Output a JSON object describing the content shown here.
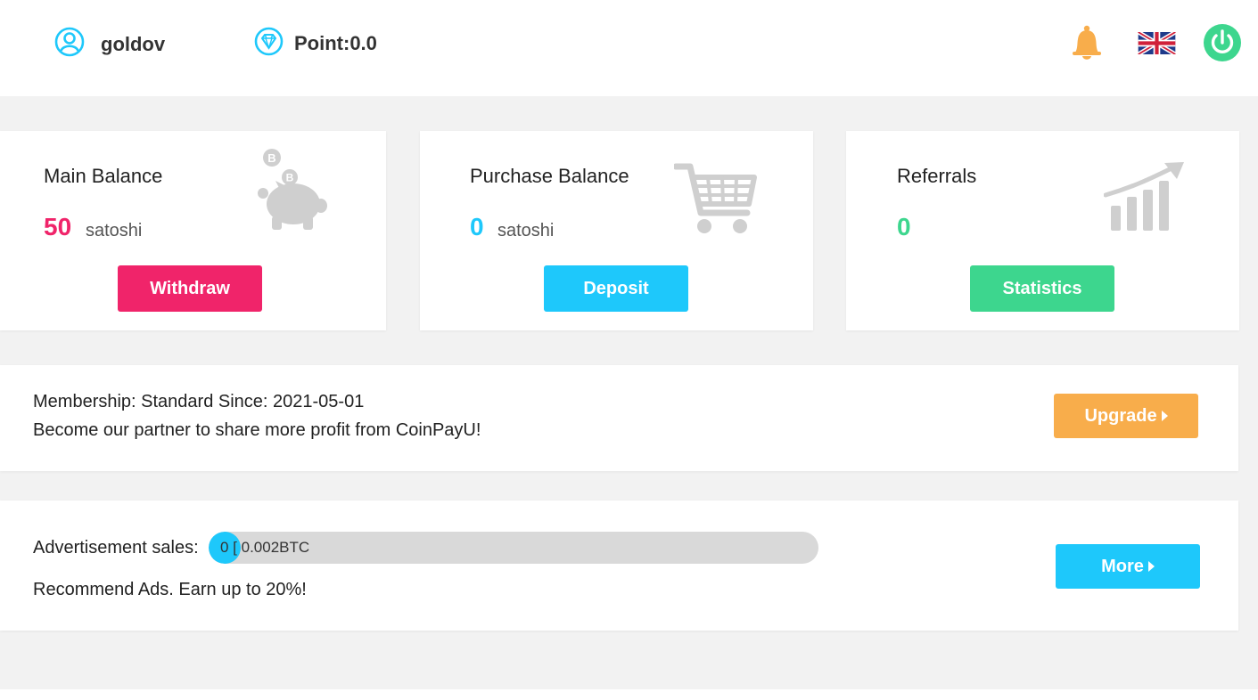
{
  "header": {
    "username": "goldov",
    "points": "Point:0.0",
    "icons": [
      "user-icon",
      "diamond-icon",
      "bell-icon",
      "uk-flag-icon",
      "power-icon"
    ]
  },
  "cards": [
    {
      "title": "Main Balance",
      "amount": "50",
      "unit": "satoshi",
      "button": "Withdraw",
      "color": "#f0246a",
      "icon": "piggy-bank-icon"
    },
    {
      "title": "Purchase Balance",
      "amount": "0",
      "unit": "satoshi",
      "button": "Deposit",
      "color": "#1ec8fb",
      "icon": "shopping-cart-icon"
    },
    {
      "title": "Referrals",
      "amount": "0",
      "unit": "",
      "button": "Statistics",
      "color": "#3dd68e",
      "icon": "growth-chart-icon"
    }
  ],
  "membership": {
    "line1": "Membership: Standard Since: 2021-05-01",
    "line2": "Become our partner to share more profit from CoinPayU!",
    "button": "Upgrade",
    "button_color": "#f8ad4b"
  },
  "ads": {
    "label": "Advertisement sales:",
    "progress_text": "0 [ 0.002BTC",
    "progress_fraction": 0,
    "line2": "Recommend Ads. Earn up to 20%!",
    "button": "More",
    "button_color": "#1ec8fb"
  },
  "colors": {
    "accent_blue": "#1ec8fb",
    "pink": "#f0246a",
    "green": "#3dd68e",
    "orange": "#f8ad4b",
    "page_bg": "#f2f2f2"
  }
}
